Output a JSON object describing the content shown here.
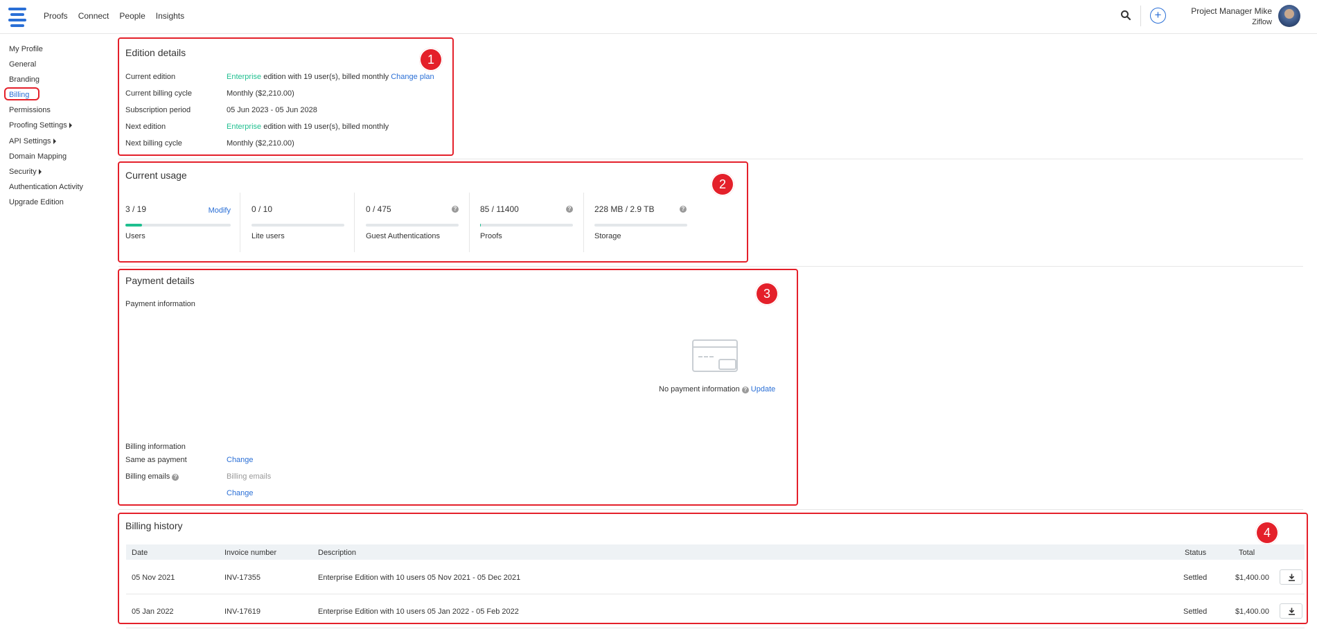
{
  "nav": {
    "items": [
      "Proofs",
      "Connect",
      "People",
      "Insights"
    ]
  },
  "user": {
    "name": "Project Manager Mike",
    "org": "Ziflow"
  },
  "sidebar": {
    "items": [
      "My Profile",
      "General",
      "Branding",
      "Billing",
      "Permissions",
      "Proofing Settings",
      "API Settings",
      "Domain Mapping",
      "Security",
      "Authentication Activity",
      "Upgrade Edition"
    ],
    "active": "Billing"
  },
  "annotations": [
    "1",
    "2",
    "3",
    "4"
  ],
  "edition": {
    "title": "Edition details",
    "current_edition_label": "Current edition",
    "current_edition_name": "Enterprise",
    "current_edition_rest": " edition with 19 user(s), billed monthly ",
    "change_plan": "Change plan",
    "billing_cycle_label": "Current billing cycle",
    "billing_cycle_value": "Monthly ($2,210.00)",
    "subscription_label": "Subscription period",
    "subscription_value": "05 Jun 2023 - 05 Jun 2028",
    "next_edition_label": "Next edition",
    "next_edition_name": "Enterprise",
    "next_edition_rest": " edition with 19 user(s), billed monthly",
    "next_cycle_label": "Next billing cycle",
    "next_cycle_value": "Monthly ($2,210.00)"
  },
  "usage": {
    "title": "Current usage",
    "modify": "Modify",
    "items": [
      {
        "value": "3 / 19",
        "caption": "Users",
        "fill": 0.158
      },
      {
        "value": "0 / 10",
        "caption": "Lite users",
        "fill": 0
      },
      {
        "value": "0 / 475",
        "caption": "Guest Authentications",
        "fill": 0
      },
      {
        "value": "85 / 11400",
        "caption": "Proofs",
        "fill": 0.0075
      },
      {
        "value": "228 MB / 2.9 TB",
        "caption": "Storage",
        "fill": 0
      }
    ]
  },
  "payment": {
    "title": "Payment details",
    "payment_info_label": "Payment information",
    "no_payment": "No payment information",
    "update": "Update",
    "billing_info_label": "Billing information",
    "same_as_payment": "Same as payment",
    "change": "Change",
    "billing_emails_label": "Billing emails",
    "billing_emails_placeholder": "Billing emails",
    "change2": "Change"
  },
  "history": {
    "title": "Billing history",
    "columns": [
      "Date",
      "Invoice number",
      "Description",
      "Status",
      "Total"
    ],
    "rows": [
      {
        "date": "05 Nov 2021",
        "invoice": "INV-17355",
        "description": "Enterprise Edition with 10 users 05 Nov 2021 - 05 Dec 2021",
        "status": "Settled",
        "total": "$1,400.00"
      },
      {
        "date": "05 Jan 2022",
        "invoice": "INV-17619",
        "description": "Enterprise Edition with 10 users 05 Jan 2022 - 05 Feb 2022",
        "status": "Settled",
        "total": "$1,400.00"
      }
    ]
  }
}
